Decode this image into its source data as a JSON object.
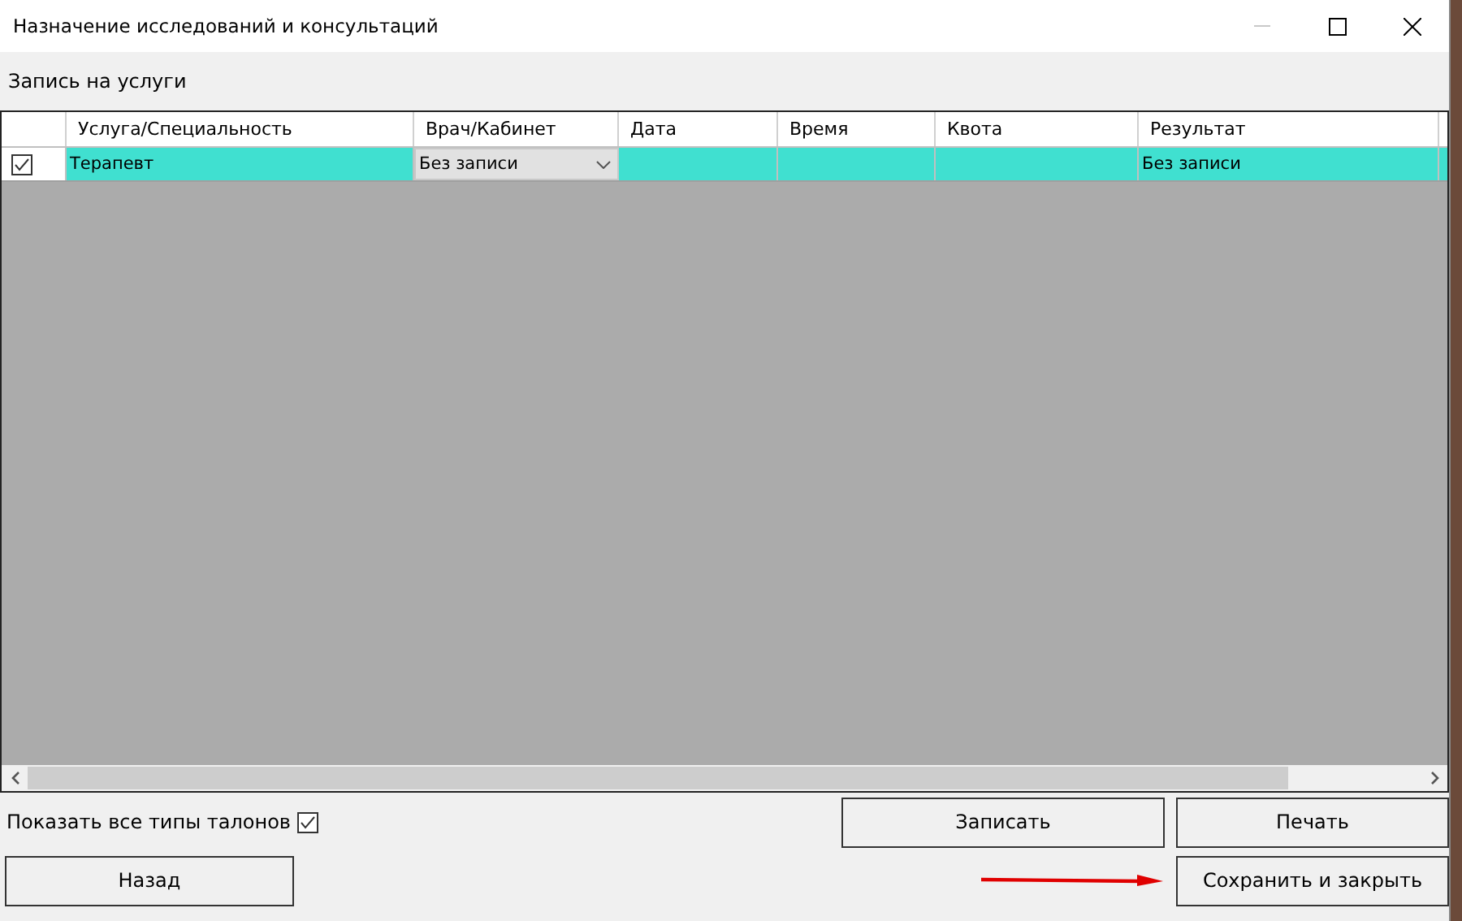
{
  "window": {
    "title": "Назначение исследований и консультаций",
    "controls": [
      {
        "kind": "minimize",
        "disabled": true
      },
      {
        "kind": "maximize",
        "disabled": false
      },
      {
        "kind": "close",
        "disabled": false
      }
    ]
  },
  "group_label": "Запись на услуги",
  "table": {
    "columns": [
      "Услуга/Специальность",
      "Врач/Кабинет",
      "Дата",
      "Время",
      "Квота",
      "Результат"
    ],
    "rows": [
      {
        "checked": true,
        "selected": true,
        "cells": [
          {
            "kind": "text",
            "text": "Терапевт"
          },
          {
            "kind": "combo",
            "text": "Без записи"
          },
          {
            "kind": "text"
          },
          {
            "kind": "text"
          },
          {
            "kind": "text"
          },
          {
            "kind": "text",
            "text": "Без записи"
          }
        ]
      }
    ]
  },
  "show_all_types": {
    "label": "Показать все типы талонов",
    "checked": true
  },
  "buttons": [
    {
      "label": "Записать"
    },
    {
      "label": "Печать"
    },
    {
      "label": "Назад"
    },
    {
      "label": "Сохранить и закрыть"
    }
  ],
  "annotation": {
    "kind": "arrow"
  }
}
